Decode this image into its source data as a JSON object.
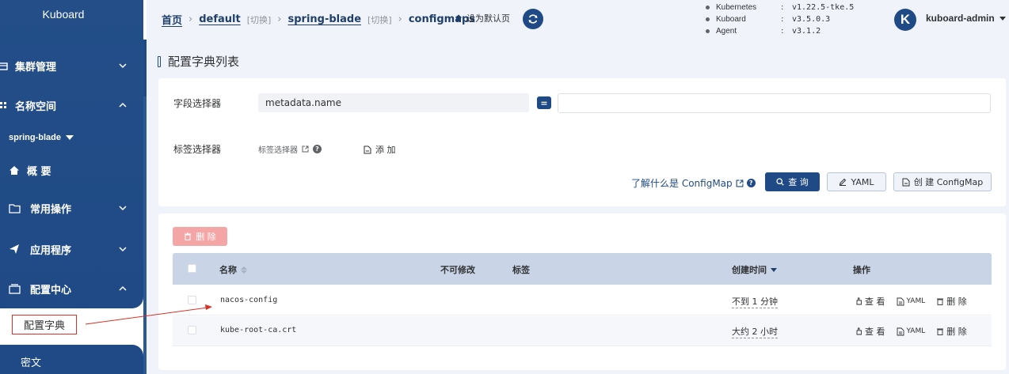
{
  "sidebar": {
    "brand": "Kuboard",
    "items": [
      {
        "label": "集群管理"
      },
      {
        "label": "名称空间"
      },
      {
        "label": "概 要"
      },
      {
        "label": "常用操作"
      },
      {
        "label": "应用程序"
      },
      {
        "label": "配置中心"
      }
    ],
    "namespace": "spring-blade",
    "active_item": "配置字典",
    "next_item": "密文"
  },
  "breadcrumb": {
    "home": "首页",
    "cluster": "default",
    "cluster_switch": "[切换]",
    "namespace": "spring-blade",
    "namespace_switch": "[切换]",
    "resource": "configmaps",
    "set_default": "设为默认页"
  },
  "versions": [
    {
      "name": "Kubernetes",
      "value": "v1.22.5-tke.5"
    },
    {
      "name": "Kuboard",
      "value": "v3.5.0.3"
    },
    {
      "name": "Agent",
      "value": "v3.1.2"
    }
  ],
  "user": {
    "avatar_letter": "K",
    "name": "kuboard-admin"
  },
  "page_title": "配置字典列表",
  "filter": {
    "field_selector_label": "字段选择器",
    "field_value": "metadata.name",
    "operator": "=",
    "label_selector_label": "标签选择器",
    "label_selector_sub": "标签选择器",
    "add_label": "添 加",
    "learn_link": "了解什么是 ConfigMap",
    "query_button": "查 询",
    "yaml_button": "YAML",
    "create_button": "创 建 ConfigMap"
  },
  "list": {
    "delete_button": "删 除",
    "columns": {
      "name": "名称",
      "immutable": "不可修改",
      "labels": "标签",
      "created": "创建时间",
      "actions": "操作"
    },
    "rows": [
      {
        "name": "nacos-config",
        "created": "不到 1 分钟"
      },
      {
        "name": "kube-root-ca.crt",
        "created": "大约 2 小时"
      }
    ],
    "actions": {
      "view": "查 看",
      "yaml": "YAML",
      "delete": "删 除"
    }
  },
  "colors": {
    "primary": "#1f4a85",
    "annotation": "#d93025",
    "table_header": "#c9d5e6"
  }
}
